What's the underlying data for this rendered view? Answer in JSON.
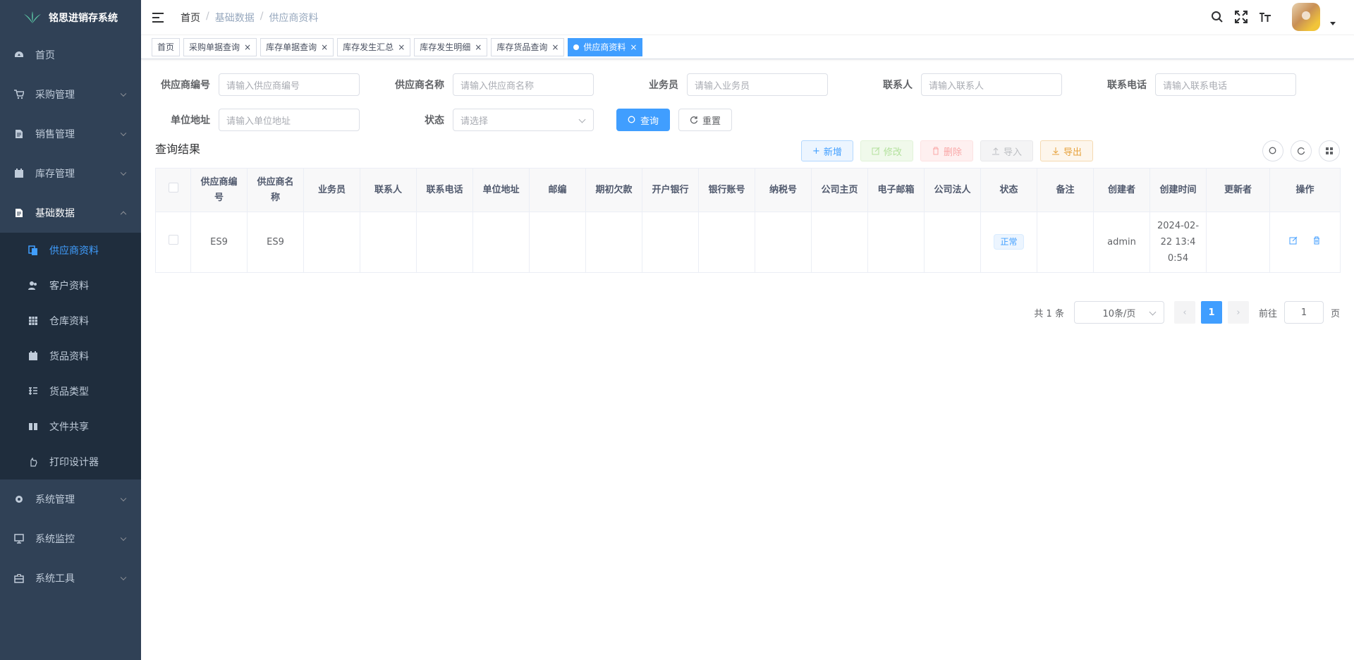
{
  "app": {
    "title": "铭思进销存系统"
  },
  "sidebar": {
    "items": [
      {
        "label": "首页",
        "icon": "dashboard-icon"
      },
      {
        "label": "采购管理",
        "icon": "cart-icon"
      },
      {
        "label": "销售管理",
        "icon": "document-icon"
      },
      {
        "label": "库存管理",
        "icon": "calendar-icon"
      },
      {
        "label": "基础数据",
        "icon": "document-icon"
      },
      {
        "label": "系统管理",
        "icon": "gear-icon"
      },
      {
        "label": "系统监控",
        "icon": "monitor-icon"
      },
      {
        "label": "系统工具",
        "icon": "toolbox-icon"
      }
    ],
    "sub_items": [
      {
        "label": "供应商资料",
        "icon": "copy-icon"
      },
      {
        "label": "客户资料",
        "icon": "peoples-icon"
      },
      {
        "label": "仓库资料",
        "icon": "table-icon"
      },
      {
        "label": "货品资料",
        "icon": "calendar-icon"
      },
      {
        "label": "货品类型",
        "icon": "tree-table-icon"
      },
      {
        "label": "文件共享",
        "icon": "book-icon"
      },
      {
        "label": "打印设计器",
        "icon": "hand-icon"
      }
    ]
  },
  "breadcrumb": {
    "home": "首页",
    "parent": "基础数据",
    "current": "供应商资料",
    "sep": "/"
  },
  "tags": [
    {
      "label": "首页"
    },
    {
      "label": "采购单据查询"
    },
    {
      "label": "库存单据查询"
    },
    {
      "label": "库存发生汇总"
    },
    {
      "label": "库存发生明细"
    },
    {
      "label": "库存货品查询"
    },
    {
      "label": "供应商资料"
    }
  ],
  "tag_close": "×",
  "form": {
    "code_label": "供应商编号",
    "code_ph": "请输入供应商编号",
    "name_label": "供应商名称",
    "name_ph": "请输入供应商名称",
    "sales_label": "业务员",
    "sales_ph": "请输入业务员",
    "contact_label": "联系人",
    "contact_ph": "请输入联系人",
    "phone_label": "联系电话",
    "phone_ph": "请输入联系电话",
    "addr_label": "单位地址",
    "addr_ph": "请输入单位地址",
    "status_label": "状态",
    "status_ph": "请选择",
    "search_btn": "查询",
    "reset_btn": "重置"
  },
  "toolbar": {
    "title": "查询结果",
    "add": "新增",
    "edit": "修改",
    "delete": "删除",
    "import": "导入",
    "export": "导出"
  },
  "table": {
    "headers": [
      "供应商编号",
      "供应商名称",
      "业务员",
      "联系人",
      "联系电话",
      "单位地址",
      "邮编",
      "期初欠款",
      "开户银行",
      "银行账号",
      "纳税号",
      "公司主页",
      "电子邮箱",
      "公司法人",
      "状态",
      "备注",
      "创建者",
      "创建时间",
      "更新者",
      "操作"
    ],
    "rows": [
      {
        "code": "ES9",
        "name": "ES9",
        "sales": "",
        "contact": "",
        "phone": "",
        "addr": "",
        "zip": "",
        "debt": "",
        "bank": "",
        "account": "",
        "tax": "",
        "home": "",
        "email": "",
        "legal": "",
        "status": "正常",
        "remark": "",
        "creator": "admin",
        "created": "2024-02-22 13:40:54",
        "updater": ""
      }
    ]
  },
  "pagination": {
    "total": "共 1 条",
    "page_size": "10条/页",
    "current": "1",
    "goto": "前往",
    "goto_value": "1",
    "page_unit": "页"
  },
  "colors": {
    "primary": "#409eff",
    "sidebar_bg": "#304156",
    "submenu_bg": "#1f2d3d"
  }
}
